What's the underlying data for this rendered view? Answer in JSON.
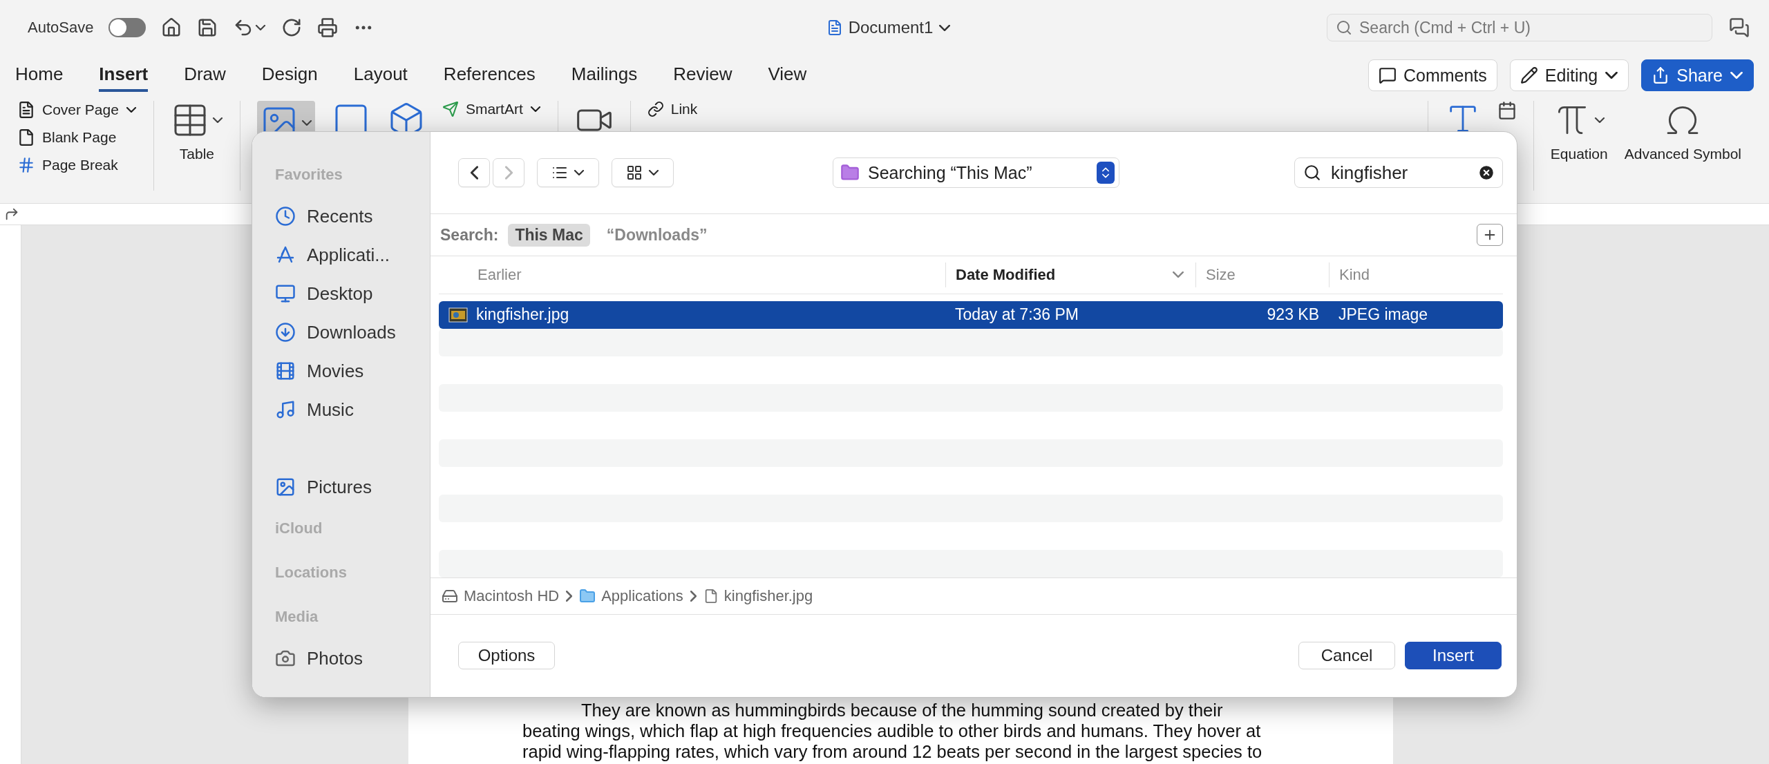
{
  "title_bar": {
    "autosave_label": "AutoSave",
    "autosave_on": false,
    "document_title": "Document1",
    "search_placeholder": "Search (Cmd + Ctrl + U)"
  },
  "ribbon_tabs": [
    {
      "label": "Home",
      "selected": false
    },
    {
      "label": "Insert",
      "selected": true
    },
    {
      "label": "Draw",
      "selected": false
    },
    {
      "label": "Design",
      "selected": false
    },
    {
      "label": "Layout",
      "selected": false
    },
    {
      "label": "References",
      "selected": false
    },
    {
      "label": "Mailings",
      "selected": false
    },
    {
      "label": "Review",
      "selected": false
    },
    {
      "label": "View",
      "selected": false
    }
  ],
  "actions": [
    {
      "kind": "comments",
      "label": "Comments"
    },
    {
      "kind": "editing",
      "label": "Editing"
    },
    {
      "kind": "share",
      "label": "Share"
    }
  ],
  "ribbon": {
    "pages": [
      "Cover Page",
      "Blank Page",
      "Page Break"
    ],
    "table": "Table",
    "smartart": "SmartArt",
    "link": "Link",
    "equation": "Equation",
    "symbol": "Advanced Symbol"
  },
  "document": {
    "lines": [
      "They are known as hummingbirds because of the humming sound created by their",
      "beating wings, which flap at high frequencies audible to other birds and humans. They hover at",
      "rapid wing-flapping rates, which vary from around 12 beats per second in the largest species to"
    ]
  },
  "dialog": {
    "sidebar": [
      {
        "kind": "heading",
        "label": "Favorites"
      },
      {
        "kind": "item",
        "label": "Recents"
      },
      {
        "kind": "item",
        "label": "Applicati..."
      },
      {
        "kind": "item",
        "label": "Desktop"
      },
      {
        "kind": "item",
        "label": "Downloads"
      },
      {
        "kind": "item",
        "label": "Movies"
      },
      {
        "kind": "item",
        "label": "Music"
      },
      {
        "kind": "item",
        "label": "Pictures"
      },
      {
        "kind": "heading",
        "label": "iCloud"
      },
      {
        "kind": "heading",
        "label": "Locations"
      },
      {
        "kind": "heading",
        "label": "Media"
      },
      {
        "kind": "media",
        "label": "Photos"
      }
    ],
    "location": "Searching “This Mac”",
    "search_value": "kingfisher",
    "scope_label": "Search:",
    "scopes": [
      {
        "label": "This Mac",
        "selected": true
      },
      {
        "label": "“Downloads”",
        "selected": false
      }
    ],
    "columns": [
      {
        "label": "Earlier",
        "sorted": false
      },
      {
        "label": "Date Modified",
        "sorted": true
      },
      {
        "label": "Size",
        "sorted": false
      },
      {
        "label": "Kind",
        "sorted": false
      }
    ],
    "rows": [
      {
        "name": "kingfisher.jpg",
        "date": "Today at 7:36 PM",
        "size": "923 KB",
        "kind": "JPEG image",
        "selected": true
      }
    ],
    "path": [
      "Macintosh HD",
      "Applications",
      "kingfisher.jpg"
    ],
    "buttons": [
      {
        "kind": "secondary",
        "label": "Options"
      },
      {
        "kind": "secondary",
        "label": "Cancel"
      },
      {
        "kind": "primary",
        "label": "Insert"
      }
    ]
  }
}
